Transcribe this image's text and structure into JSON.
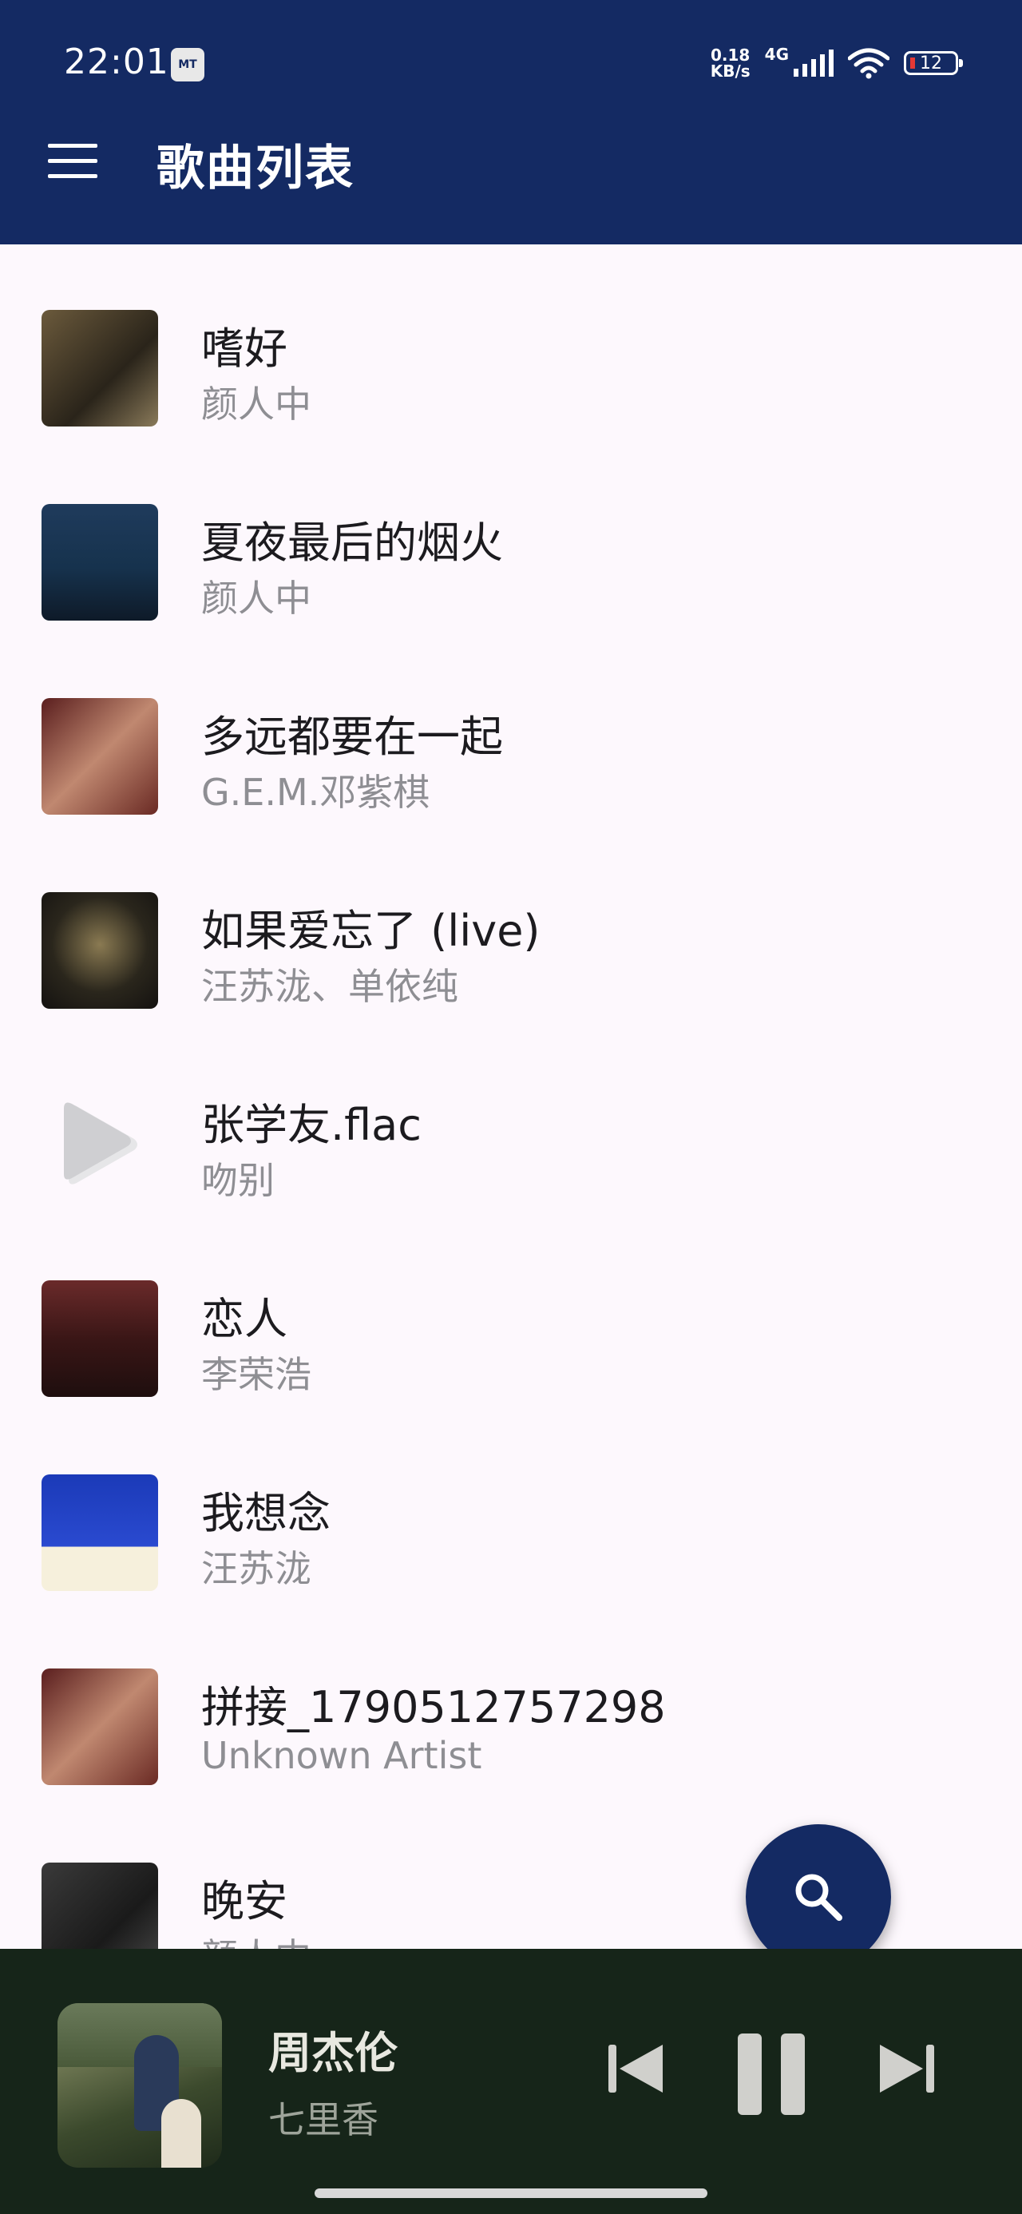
{
  "status": {
    "time": "22:01",
    "app_icon": "MT",
    "net_speed_value": "0.18",
    "net_speed_unit": "KB/s",
    "network_type": "4G",
    "battery": "12"
  },
  "appbar": {
    "title": "歌曲列表"
  },
  "songs": [
    {
      "title": "嗜好",
      "artist": "颜人中",
      "cover": "album-art"
    },
    {
      "title": "夏夜最后的烟火",
      "artist": "颜人中",
      "cover": "album-art"
    },
    {
      "title": "多远都要在一起",
      "artist": "G.E.M.邓紫棋",
      "cover": "album-art"
    },
    {
      "title": "如果爱忘了 (live)",
      "artist": "汪苏泷、单依纯",
      "cover": "album-art"
    },
    {
      "title": "张学友.flac",
      "artist": "吻别",
      "cover": "play-icon"
    },
    {
      "title": "恋人",
      "artist": "李荣浩",
      "cover": "album-art"
    },
    {
      "title": "我想念",
      "artist": "汪苏泷",
      "cover": "album-art"
    },
    {
      "title": "拼接_1790512757298",
      "artist": "Unknown Artist",
      "cover": "album-art"
    },
    {
      "title": "晚安",
      "artist": "颜人中",
      "cover": "album-art"
    }
  ],
  "now_playing": {
    "title": "周杰伦",
    "artist": "七里香",
    "controls": [
      "previous-icon",
      "pause-icon",
      "next-icon"
    ]
  },
  "colors": {
    "primary": "#142a63",
    "background": "#fdf8fd",
    "player_bar": "#162519",
    "title_text": "#1c1b1f",
    "secondary_text": "#8e8e93"
  }
}
